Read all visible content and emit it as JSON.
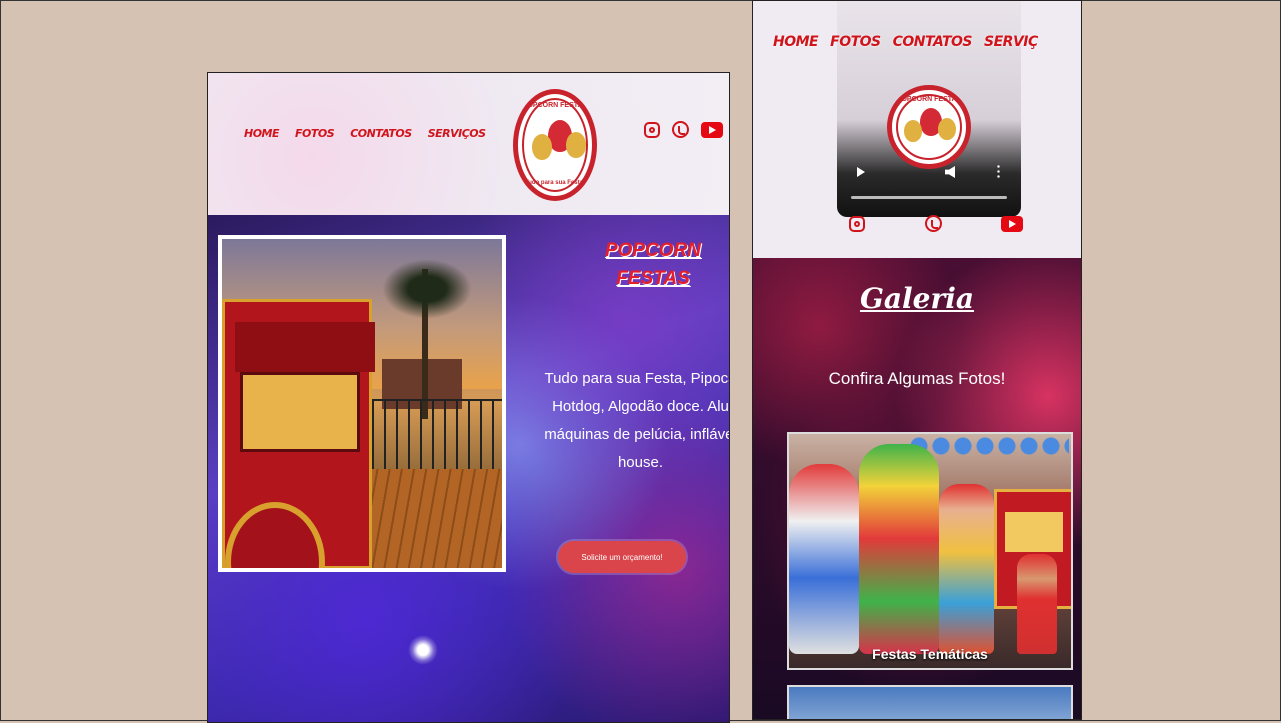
{
  "nav": [
    "HOME",
    "FOTOS",
    "CONTATOS",
    "SERVIÇOS"
  ],
  "nav_right": [
    "HOME",
    "FOTOS",
    "CONTATOS",
    "SERVIÇ"
  ],
  "logo": {
    "name": "POPCORN FESTAS",
    "tagline": "Tudo para sua Festa!"
  },
  "social": [
    "instagram-icon",
    "whatsapp-icon",
    "youtube-icon"
  ],
  "hero": {
    "title_line1": "POPCORN",
    "title_line2": "FESTAS",
    "description": "Tudo para sua Festa, Pipoca, Hotdog, Algodão doce. Alu máquinas de pelúcia, infláveis house.",
    "desc_lines": [
      "Tudo para sua Festa, Pipoca",
      "Hotdog, Algodão doce. Alu",
      "máquinas de pelúcia, inflávei",
      "house."
    ],
    "cta": "Solicite um orçamento!"
  },
  "gallery": {
    "title": "Galeria",
    "subtitle": "Confira Algumas Fotos!",
    "cards": [
      {
        "caption": "Festas Temáticas"
      }
    ]
  },
  "colors": {
    "brand_red": "#d0141c",
    "background": "#d5c2b3",
    "cta": "#d9454a"
  }
}
